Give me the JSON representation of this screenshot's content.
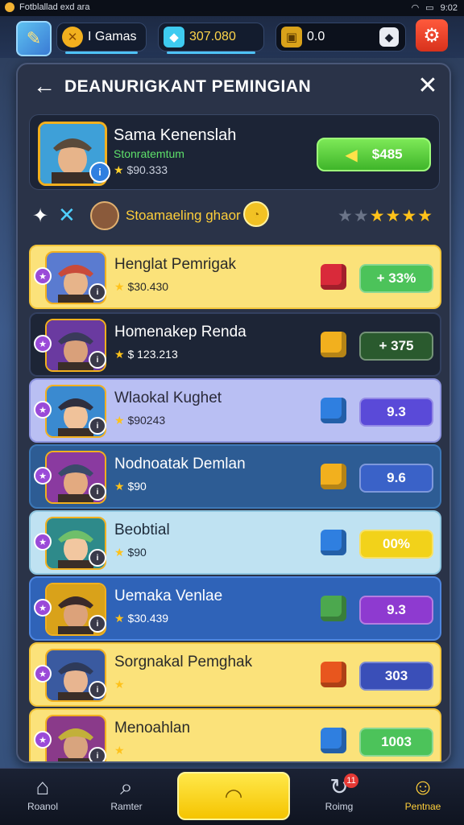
{
  "status_bar": {
    "app_text": "Fotblallad exd ara",
    "time": "9:02"
  },
  "top_bar": {
    "games_label": "I Gamas",
    "gems_value": "307.080",
    "coins_value": "0.0"
  },
  "panel": {
    "title": "DEANURIGKANT PEMINGIAN",
    "me": {
      "name": "Sama Kenenslah",
      "subtitle": "Stonratemtum",
      "stats": "$90.333",
      "button_value": "$485"
    },
    "filter": {
      "label": "Stoamaeling ghaor",
      "star_rating": 5
    }
  },
  "players": [
    {
      "name": "Henglat Pemrigak",
      "stats": "$30.430",
      "score": "+ 33%",
      "cube_color": "#d92a3a",
      "score_color": "#4cc35a",
      "bg": "#fbe27a",
      "text": "#2a2a2a",
      "border": "#f2c43a"
    },
    {
      "name": "Homenakep Renda",
      "stats": "$ 123.213",
      "score": "+ 375",
      "cube_color": "#f2b01e",
      "score_color": "#2a5a2e",
      "bg": "#1d2536",
      "text": "#ffffff",
      "border": "#334060"
    },
    {
      "name": "Wlaokal Kughet",
      "stats": "$90243",
      "score": "9.3",
      "cube_color": "#2f7fe0",
      "score_color": "#5a4ad8",
      "bg": "#b9bff3",
      "text": "#2a2a3a",
      "border": "#8e95e0"
    },
    {
      "name": "Nodnoatak Demlan",
      "stats": "$90",
      "score": "9.6",
      "cube_color": "#f2b01e",
      "score_color": "#3a62c8",
      "bg": "#2d5c94",
      "text": "#ffffff",
      "border": "#3d78b8"
    },
    {
      "name": "Beobtial",
      "stats": "$90",
      "score": "00%",
      "cube_color": "#2f7fe0",
      "score_color": "#f2d21a",
      "bg": "#bfe2f2",
      "text": "#1e2b3a",
      "border": "#8fc6e0"
    },
    {
      "name": "Uemaka Venlae",
      "stats": "$30.439",
      "score": "9.3",
      "cube_color": "#4ca84e",
      "score_color": "#8e3ad0",
      "bg": "#2f63b8",
      "text": "#ffffff",
      "border": "#4e86e0"
    },
    {
      "name": "Sorgnakal Pemghak",
      "stats": "",
      "score": "303",
      "cube_color": "#e8561e",
      "score_color": "#3a4fb8",
      "bg": "#fbe27a",
      "text": "#2a2a2a",
      "border": "#f2c43a"
    },
    {
      "name": "Menoahlan",
      "stats": "",
      "score": "1003",
      "cube_color": "#2f7fe0",
      "score_color": "#4cc35a",
      "bg": "#fbe27a",
      "text": "#2a2a2a",
      "border": "#f2c43a"
    }
  ],
  "bottom_nav": {
    "item1": "Roanol",
    "item2": "Ramter",
    "item4": "Roimg",
    "item4_badge": "11",
    "item5": "Pentnae"
  }
}
